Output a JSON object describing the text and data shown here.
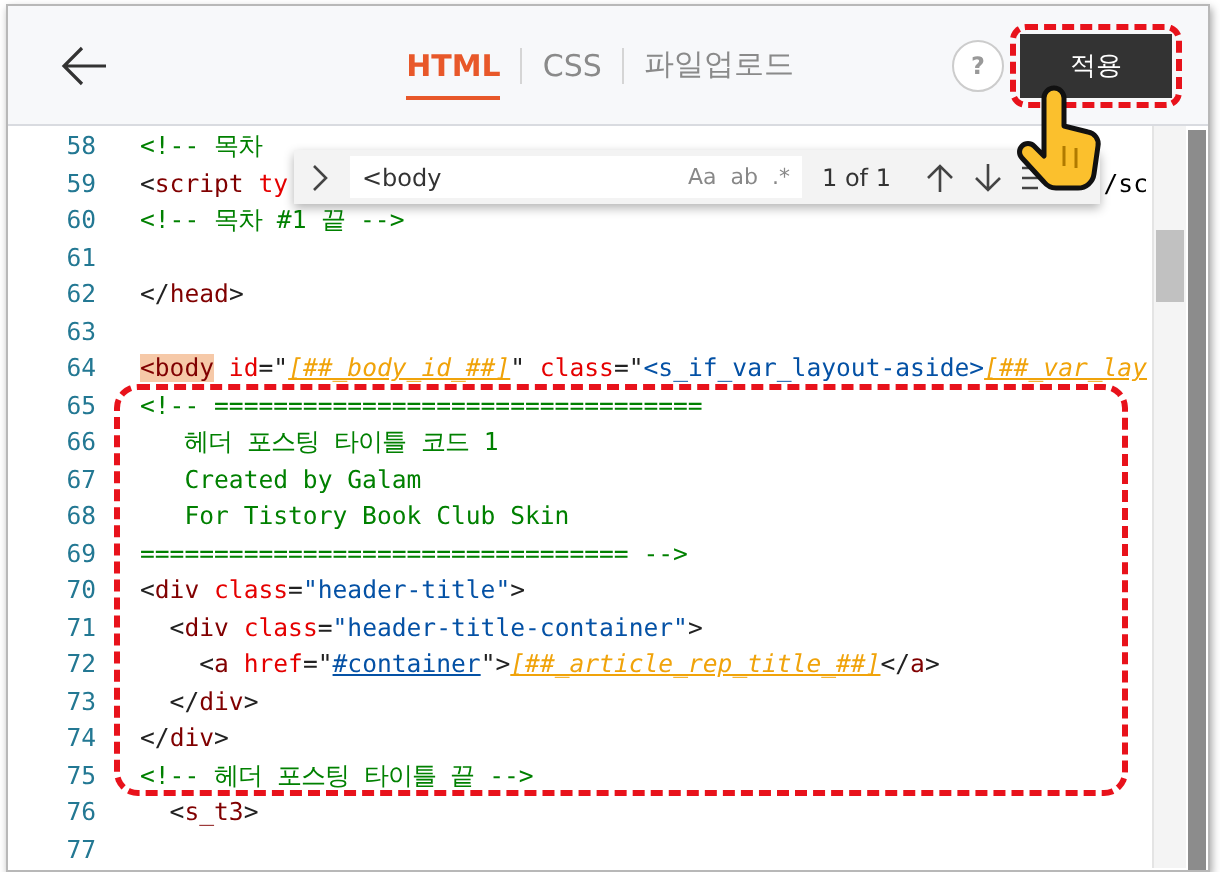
{
  "header": {
    "tabs": [
      {
        "label": "HTML",
        "selected": true
      },
      {
        "label": "CSS",
        "selected": false
      },
      {
        "label": "파일업로드",
        "selected": false
      }
    ],
    "help": "?",
    "apply_button": "적용"
  },
  "find_widget": {
    "query": "<body",
    "options": [
      {
        "label": "Aa",
        "on": false
      },
      {
        "label": "ab",
        "on": false
      },
      {
        "label": ".*",
        "on": false
      }
    ],
    "count": "1 of 1"
  },
  "editor": {
    "lines": [
      {
        "num": "58",
        "tokens": [
          {
            "kind": "comment",
            "text": "<!-- 목차"
          }
        ]
      },
      {
        "num": "59",
        "tokens": [
          {
            "kind": "punct",
            "text": "<"
          },
          {
            "kind": "tag",
            "text": "script"
          },
          {
            "kind": "attr",
            "text": " ty"
          }
        ],
        "tail": "/sc"
      },
      {
        "num": "60",
        "tokens": [
          {
            "kind": "comment",
            "text": "<!-- 목차 #1 끝 -->"
          }
        ]
      },
      {
        "num": "61"
      },
      {
        "num": "62",
        "tokens": [
          {
            "kind": "punct",
            "text": "</"
          },
          {
            "kind": "tag",
            "text": "head"
          },
          {
            "kind": "punct",
            "text": ">"
          }
        ]
      },
      {
        "num": "63"
      },
      {
        "num": "64",
        "tokens": [
          {
            "kind": "match",
            "text": "<body"
          },
          {
            "kind": "attr",
            "text": " id"
          },
          {
            "kind": "punct",
            "text": "=\""
          },
          {
            "kind": "tpl",
            "text": "[##_body_id_##]"
          },
          {
            "kind": "punct",
            "text": "\""
          },
          {
            "kind": "attr",
            "text": " class"
          },
          {
            "kind": "punct",
            "text": "=\""
          },
          {
            "kind": "str",
            "text": "<s_if_var_layout-aside>"
          },
          {
            "kind": "tpl",
            "text": "[##_var_lay"
          }
        ]
      },
      {
        "num": "65",
        "tokens": [
          {
            "kind": "comment",
            "text": "<!-- ================================="
          }
        ]
      },
      {
        "num": "66",
        "tokens": [
          {
            "kind": "comment",
            "text": "   헤더 포스팅 타이틀 코드 1"
          }
        ]
      },
      {
        "num": "67",
        "tokens": [
          {
            "kind": "comment",
            "text": "   Created by Galam"
          }
        ]
      },
      {
        "num": "68",
        "tokens": [
          {
            "kind": "comment",
            "text": "   For Tistory Book Club Skin"
          }
        ]
      },
      {
        "num": "69",
        "tokens": [
          {
            "kind": "comment",
            "text": "================================= -->"
          }
        ]
      },
      {
        "num": "70",
        "tokens": [
          {
            "kind": "punct",
            "text": "<"
          },
          {
            "kind": "tag",
            "text": "div"
          },
          {
            "kind": "attr",
            "text": " class"
          },
          {
            "kind": "punct",
            "text": "="
          },
          {
            "kind": "str",
            "text": "\"header-title\""
          },
          {
            "kind": "punct",
            "text": ">"
          }
        ]
      },
      {
        "num": "71",
        "tokens": [
          {
            "kind": "punct",
            "text": "  <"
          },
          {
            "kind": "tag",
            "text": "div"
          },
          {
            "kind": "attr",
            "text": " class"
          },
          {
            "kind": "punct",
            "text": "="
          },
          {
            "kind": "str",
            "text": "\"header-title-container\""
          },
          {
            "kind": "punct",
            "text": ">"
          }
        ]
      },
      {
        "num": "72",
        "tokens": [
          {
            "kind": "punct",
            "text": "    <"
          },
          {
            "kind": "tag",
            "text": "a"
          },
          {
            "kind": "attr",
            "text": " href"
          },
          {
            "kind": "punct",
            "text": "=\""
          },
          {
            "kind": "link",
            "text": "#container"
          },
          {
            "kind": "punct",
            "text": "\">"
          },
          {
            "kind": "tpl",
            "text": "[##_article_rep_title_##]"
          },
          {
            "kind": "punct",
            "text": "</"
          },
          {
            "kind": "tag",
            "text": "a"
          },
          {
            "kind": "punct",
            "text": ">"
          }
        ]
      },
      {
        "num": "73",
        "tokens": [
          {
            "kind": "punct",
            "text": "  </"
          },
          {
            "kind": "tag",
            "text": "div"
          },
          {
            "kind": "punct",
            "text": ">"
          }
        ]
      },
      {
        "num": "74",
        "tokens": [
          {
            "kind": "punct",
            "text": "</"
          },
          {
            "kind": "tag",
            "text": "div"
          },
          {
            "kind": "punct",
            "text": ">"
          }
        ]
      },
      {
        "num": "75",
        "tokens": [
          {
            "kind": "comment",
            "text": "<!-- 헤더 포스팅 타이틀 끝 -->"
          }
        ]
      },
      {
        "num": "76",
        "tokens": [
          {
            "kind": "punct",
            "text": "  <"
          },
          {
            "kind": "tag",
            "text": "s_t3"
          },
          {
            "kind": "punct",
            "text": ">"
          }
        ]
      },
      {
        "num": "77"
      }
    ]
  }
}
